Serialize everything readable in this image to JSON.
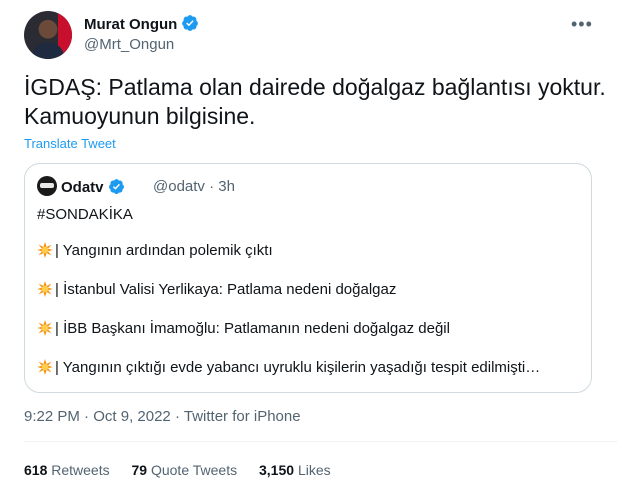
{
  "author": {
    "name": "Murat Ongun",
    "handle": "@Mrt_Ongun"
  },
  "more_icon": "more-icon",
  "tweet": {
    "text": "İGDAŞ: Patlama olan dairede doğalgaz bağlantısı yoktur. Kamuoyunun bilgisine.",
    "translate_label": "Translate Tweet"
  },
  "quote": {
    "name": "Odatv",
    "handle": "@odatv",
    "separator": "·",
    "time": "3h",
    "lines": [
      "#SONDAKİKA",
      "| Yangının ardından polemik çıktı",
      "| İstanbul Valisi Yerlikaya: Patlama nedeni doğalgaz",
      "| İBB Başkanı İmamoğlu: Patlamanın nedeni doğalgaz değil",
      "| Yangının çıktığı evde yabancı uyruklu kişilerin yaşadığı tespit edilmişti…"
    ]
  },
  "meta": {
    "time": "9:22 PM",
    "separator1": "·",
    "date": "Oct 9, 2022",
    "separator2": "·",
    "source": "Twitter for iPhone"
  },
  "stats": {
    "retweets_count": "618",
    "retweets_label": "Retweets",
    "quotes_count": "79",
    "quotes_label": "Quote Tweets",
    "likes_count": "3,150",
    "likes_label": "Likes"
  },
  "colors": {
    "link": "#1d9bf0",
    "secondary_text": "#536471",
    "border": "#cfd9de"
  }
}
